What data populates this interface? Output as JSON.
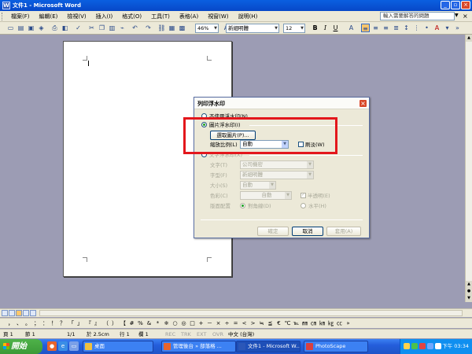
{
  "window": {
    "title": "文件1 - Microsoft Word",
    "icon_letter": "W",
    "minimize": "_",
    "restore": "▫",
    "close": "×"
  },
  "menu": {
    "items": [
      "檔案(F)",
      "編輯(E)",
      "檢視(V)",
      "插入(I)",
      "格式(O)",
      "工具(T)",
      "表格(A)",
      "視窗(W)",
      "說明(H)"
    ],
    "help_placeholder": "輸入需要解答的問題",
    "help_arrow": "▼",
    "close_doc": "×"
  },
  "toolbar": {
    "zoom": "46%",
    "font_name": "新細明體",
    "font_size": "12",
    "bold": "B",
    "italic": "I",
    "underline": "U",
    "font_color_letter": "A"
  },
  "dialog": {
    "title": "列印浮水印",
    "close": "×",
    "no_watermark": "不使用浮水印(N)",
    "picture_watermark": "圖片浮水印(I)",
    "select_picture": "選取圖片(P)...",
    "scale_label": "縮放比例(L)",
    "scale_value": "自動",
    "washout": "刷淡(W)",
    "text_watermark": "文字浮水印(X)",
    "text_label": "文字(T)",
    "text_value": "公司機密",
    "font_label": "字型(F)",
    "font_value": "新細明體",
    "size_label": "大小(S)",
    "size_value": "自動",
    "color_label": "色彩(C)",
    "color_value": "自動",
    "semitransparent": "半透明(E)",
    "layout_label": "版面配置",
    "diagonal": "對角線(D)",
    "horizontal": "水平(H)",
    "apply": "套用(A)",
    "ok": "確定",
    "cancel": "取消",
    "highlight_color": "#e3171c"
  },
  "status": {
    "page": "頁 1",
    "section": "節 1",
    "page_of": "1/1",
    "at": "於 2.5cm",
    "line": "行 1",
    "col": "欄 1",
    "rec": "REC",
    "trk": "TRK",
    "ext": "EXT",
    "ovr": "OVR",
    "lang": "中文 (台灣)"
  },
  "taskbar": {
    "start": "開始",
    "tasks": [
      "桌面",
      "管理後台 » 部落格 ...",
      "文件1 - Microsoft W...",
      "PhotoScape"
    ],
    "clock": "下午 03:34"
  },
  "symbols": [
    "，",
    "、",
    "。",
    "；",
    "：",
    "！",
    "？",
    "「",
    "」",
    "『",
    "』",
    "（",
    "）",
    "【",
    "#",
    "%",
    "&",
    "*",
    "※",
    "○",
    "◎",
    "□",
    "+",
    "－",
    "×",
    "÷",
    "=",
    "<",
    ">",
    "≒",
    "≦",
    "€",
    "℃",
    "℡",
    "㎜",
    "㎝",
    "㎞",
    "㎏",
    "㏄",
    "»"
  ]
}
